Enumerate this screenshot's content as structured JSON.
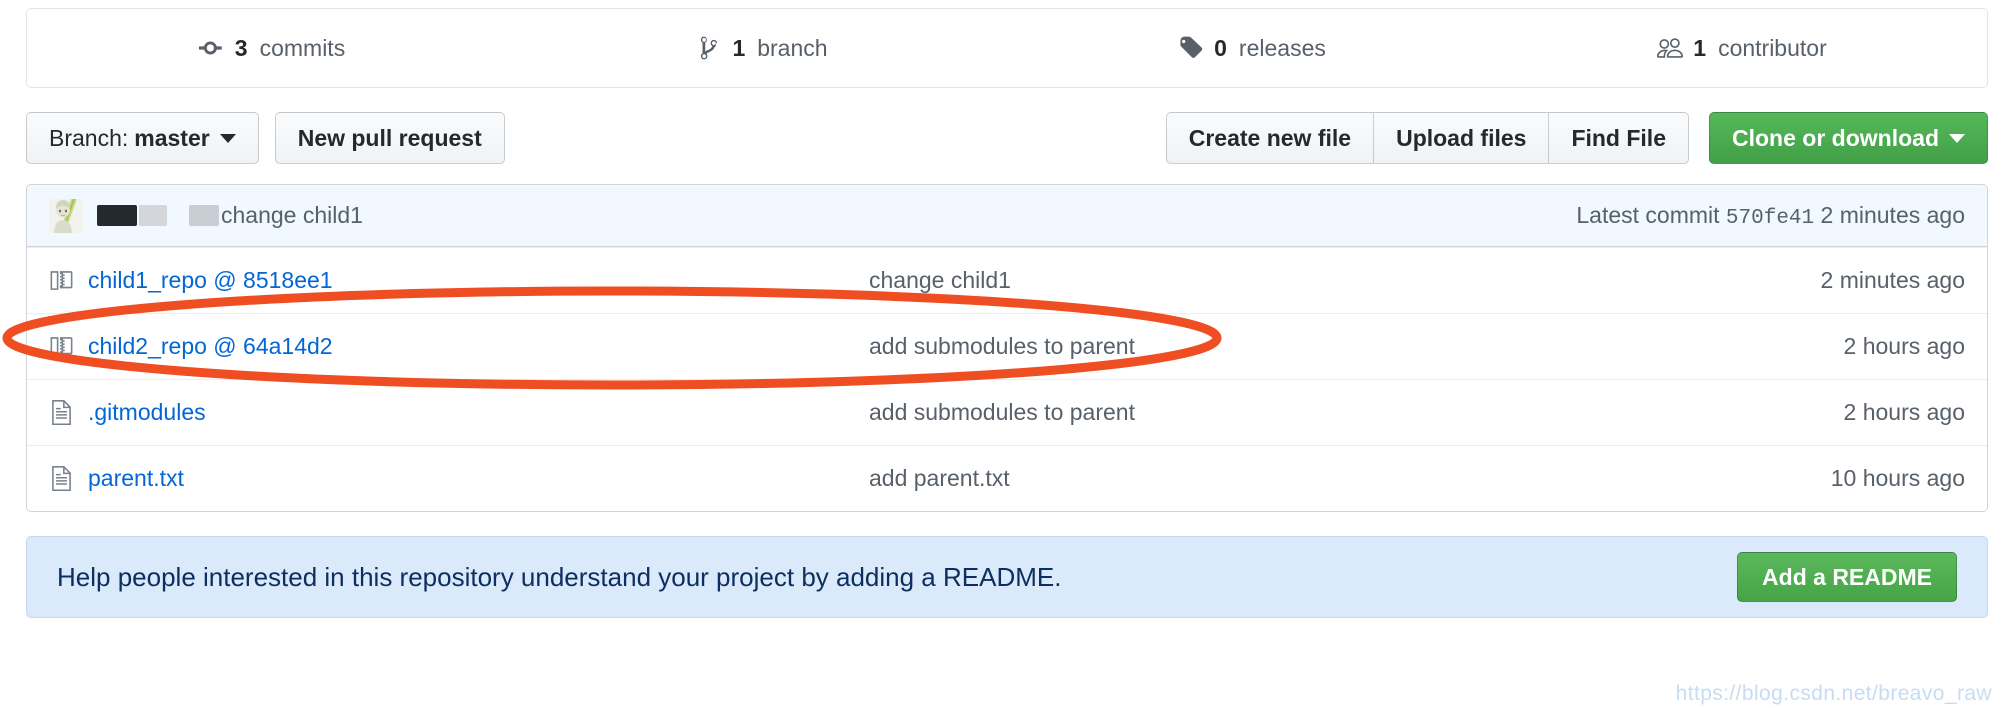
{
  "stats": [
    {
      "icon": "commit-icon",
      "count": "3",
      "label": "commits",
      "name": "stat-commits"
    },
    {
      "icon": "branch-icon",
      "count": "1",
      "label": "branch",
      "name": "stat-branches"
    },
    {
      "icon": "tag-icon",
      "count": "0",
      "label": "releases",
      "name": "stat-releases"
    },
    {
      "icon": "people-icon",
      "count": "1",
      "label": "contributor",
      "name": "stat-contributors"
    }
  ],
  "toolbar": {
    "branch_prefix": "Branch:",
    "branch_name": "master",
    "new_pull_request": "New pull request",
    "create_new_file": "Create new file",
    "upload_files": "Upload files",
    "find_file": "Find File",
    "clone_or_download": "Clone or download"
  },
  "commit_bar": {
    "message": "change child1",
    "latest_commit_label": "Latest commit",
    "sha": "570fe41",
    "age": "2 minutes ago"
  },
  "files": [
    {
      "icon": "submodule-icon",
      "name": "child1_repo @ 8518ee1",
      "message": "change child1",
      "age": "2 minutes ago"
    },
    {
      "icon": "submodule-icon",
      "name": "child2_repo @ 64a14d2",
      "message": "add submodules to parent",
      "age": "2 hours ago"
    },
    {
      "icon": "file-icon",
      "name": ".gitmodules",
      "message": "add submodules to parent",
      "age": "2 hours ago"
    },
    {
      "icon": "file-icon",
      "name": "parent.txt",
      "message": "add parent.txt",
      "age": "10 hours ago"
    }
  ],
  "readme": {
    "text": "Help people interested in this repository understand your project by adding a README.",
    "button": "Add a README"
  },
  "watermark": "https://blog.csdn.net/breavo_raw",
  "colors": {
    "link": "#0366d6",
    "green_button": "#45a546",
    "annotation": "#ef4e23",
    "commit_bar_bg": "#f1f8ff",
    "readme_bg": "#dbeafb"
  }
}
